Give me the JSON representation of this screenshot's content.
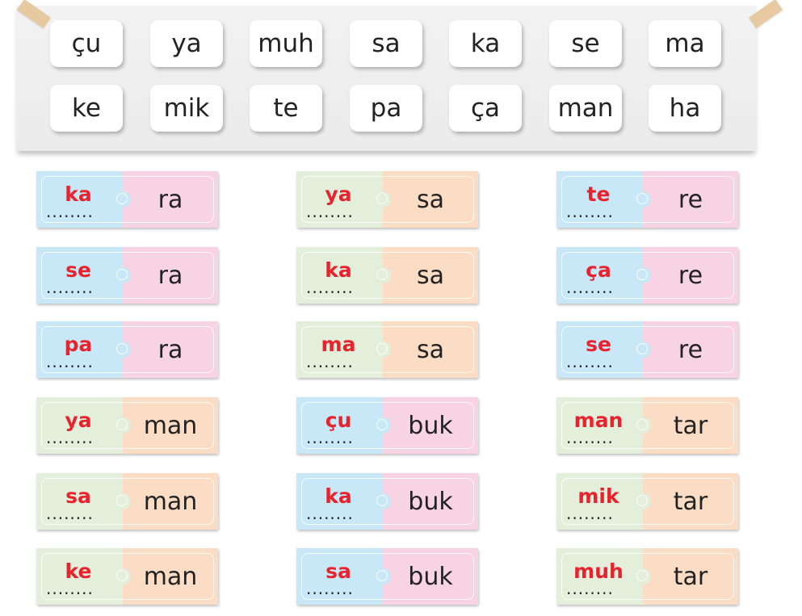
{
  "board": {
    "rows": [
      [
        "çu",
        "ya",
        "muh",
        "sa",
        "ka",
        "se",
        "ma"
      ],
      [
        "ke",
        "mik",
        "te",
        "pa",
        "ça",
        "man",
        "ha"
      ]
    ]
  },
  "blank_placeholder": "........",
  "puzzles": [
    {
      "answer": "ka",
      "syllable": "ra",
      "left_color": "#c9e8f7",
      "right_color": "#f7d3e4"
    },
    {
      "answer": "ya",
      "syllable": "sa",
      "left_color": "#e3efdb",
      "right_color": "#fbdcc4"
    },
    {
      "answer": "te",
      "syllable": "re",
      "left_color": "#c9e8f7",
      "right_color": "#f7d3e4"
    },
    {
      "answer": "se",
      "syllable": "ra",
      "left_color": "#c9e8f7",
      "right_color": "#f7d3e4"
    },
    {
      "answer": "ka",
      "syllable": "sa",
      "left_color": "#e3efdb",
      "right_color": "#fbdcc4"
    },
    {
      "answer": "ça",
      "syllable": "re",
      "left_color": "#c9e8f7",
      "right_color": "#f7d3e4"
    },
    {
      "answer": "pa",
      "syllable": "ra",
      "left_color": "#c9e8f7",
      "right_color": "#f7d3e4"
    },
    {
      "answer": "ma",
      "syllable": "sa",
      "left_color": "#e3efdb",
      "right_color": "#fbdcc4"
    },
    {
      "answer": "se",
      "syllable": "re",
      "left_color": "#c9e8f7",
      "right_color": "#f7d3e4"
    },
    {
      "answer": "ya",
      "syllable": "man",
      "left_color": "#e3efdb",
      "right_color": "#fbdcc4"
    },
    {
      "answer": "çu",
      "syllable": "buk",
      "left_color": "#c9e8f7",
      "right_color": "#f7d3e4"
    },
    {
      "answer": "man",
      "syllable": "tar",
      "left_color": "#e3efdb",
      "right_color": "#fbdcc4"
    },
    {
      "answer": "sa",
      "syllable": "man",
      "left_color": "#e3efdb",
      "right_color": "#fbdcc4"
    },
    {
      "answer": "ka",
      "syllable": "buk",
      "left_color": "#c9e8f7",
      "right_color": "#f7d3e4"
    },
    {
      "answer": "mik",
      "syllable": "tar",
      "left_color": "#e3efdb",
      "right_color": "#fbdcc4"
    },
    {
      "answer": "ke",
      "syllable": "man",
      "left_color": "#e3efdb",
      "right_color": "#fbdcc4"
    },
    {
      "answer": "sa",
      "syllable": "buk",
      "left_color": "#c9e8f7",
      "right_color": "#f7d3e4"
    },
    {
      "answer": "muh",
      "syllable": "tar",
      "left_color": "#e3efdb",
      "right_color": "#fbdcc4"
    }
  ],
  "colors": {
    "answer_text": "#e8232e",
    "board_background": "#efefef",
    "tape": "#e7c79c"
  }
}
